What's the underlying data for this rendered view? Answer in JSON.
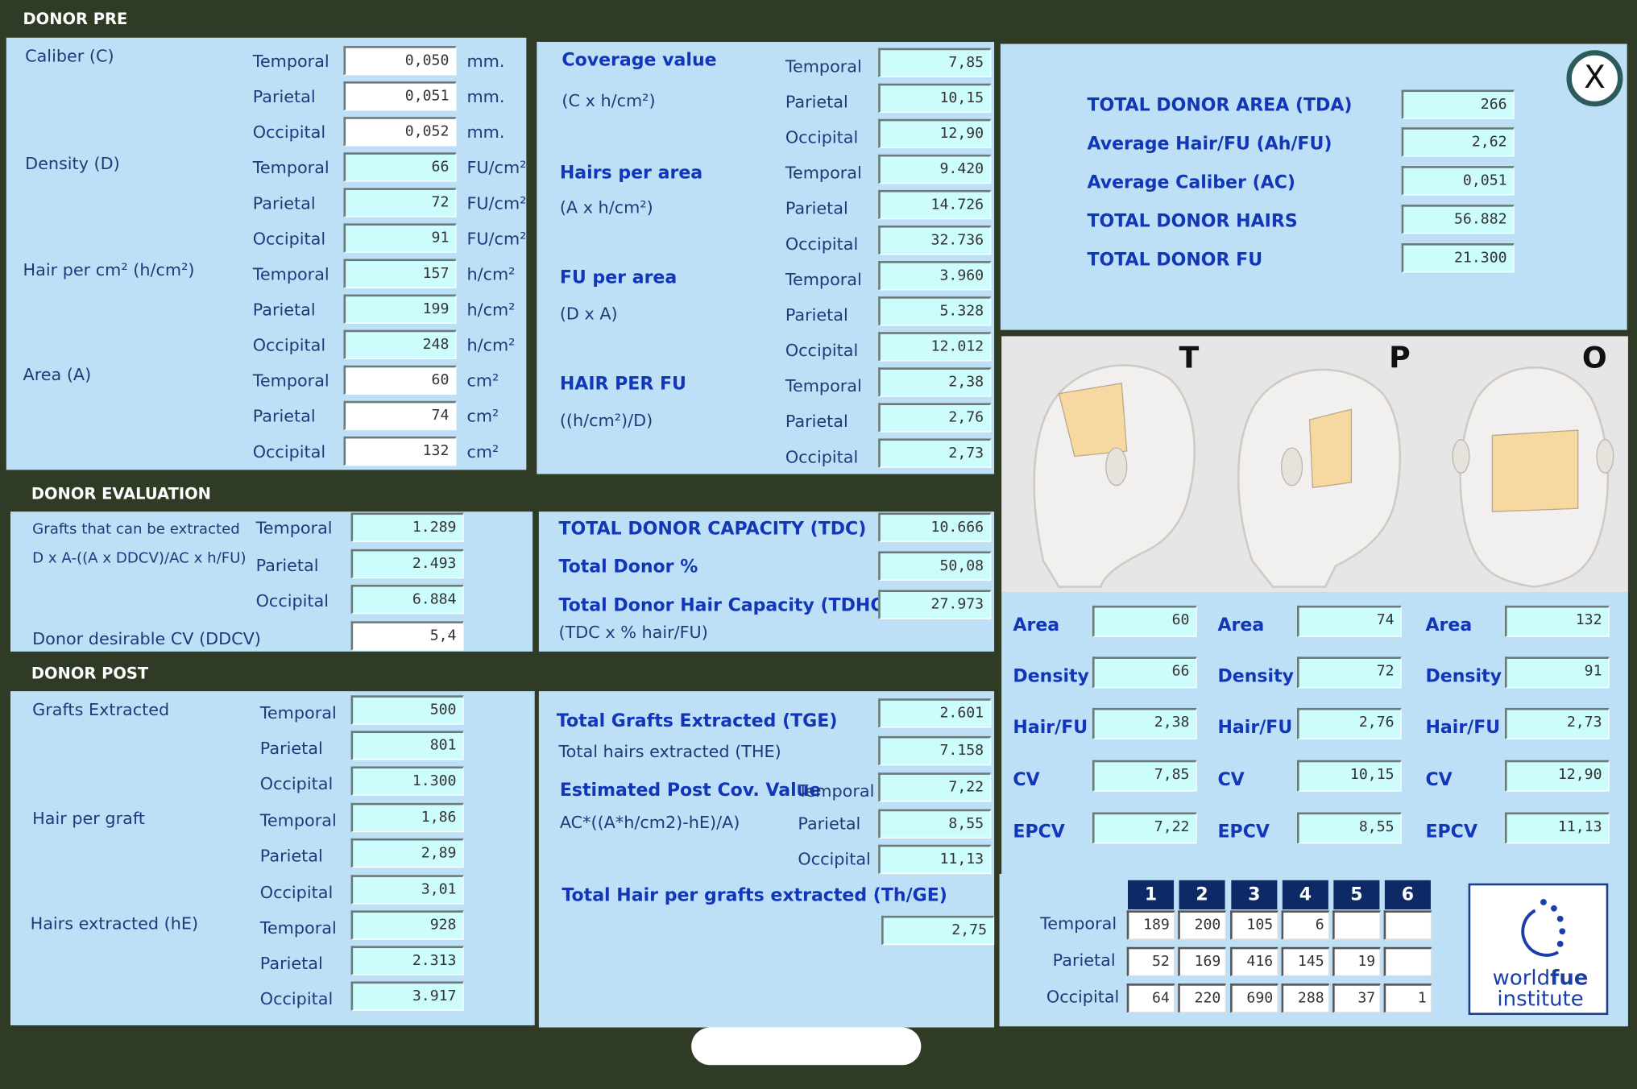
{
  "donor_pre": {
    "header": "DONOR PRE",
    "caliber_label": "Caliber (C)",
    "density_label": "Density (D)",
    "hair_per_cm_label": "Hair per cm² (h/cm²)",
    "area_label": "Area (A)",
    "rows": [
      {
        "region": "Temporal",
        "value": "0,050",
        "unit": "mm."
      },
      {
        "region": "Parietal",
        "value": "0,051",
        "unit": "mm."
      },
      {
        "region": "Occipital",
        "value": "0,052",
        "unit": "mm."
      },
      {
        "region": "Temporal",
        "value": "66",
        "unit": "FU/cm²"
      },
      {
        "region": "Parietal",
        "value": "72",
        "unit": "FU/cm²"
      },
      {
        "region": "Occipital",
        "value": "91",
        "unit": "FU/cm²"
      },
      {
        "region": "Temporal",
        "value": "157",
        "unit": "h/cm²"
      },
      {
        "region": "Parietal",
        "value": "199",
        "unit": "h/cm²"
      },
      {
        "region": "Occipital",
        "value": "248",
        "unit": "h/cm²"
      },
      {
        "region": "Temporal",
        "value": "60",
        "unit": "cm²"
      },
      {
        "region": "Parietal",
        "value": "74",
        "unit": "cm²"
      },
      {
        "region": "Occipital",
        "value": "132",
        "unit": "cm²"
      }
    ]
  },
  "middle_top": {
    "coverage_label": "Coverage value",
    "coverage_formula": "(C x h/cm²)",
    "hairs_area_label": "Hairs per area",
    "hairs_area_formula": "(A x h/cm²)",
    "fu_area_label": "FU per area",
    "fu_area_formula": "(D x A)",
    "hair_fu_label": "HAIR PER FU",
    "hair_fu_formula": "((h/cm²)/D)",
    "rows": [
      {
        "region": "Temporal",
        "value": "7,85"
      },
      {
        "region": "Parietal",
        "value": "10,15"
      },
      {
        "region": "Occipital",
        "value": "12,90"
      },
      {
        "region": "Temporal",
        "value": "9.420"
      },
      {
        "region": "Parietal",
        "value": "14.726"
      },
      {
        "region": "Occipital",
        "value": "32.736"
      },
      {
        "region": "Temporal",
        "value": "3.960"
      },
      {
        "region": "Parietal",
        "value": "5.328"
      },
      {
        "region": "Occipital",
        "value": "12.012"
      },
      {
        "region": "Temporal",
        "value": "2,38"
      },
      {
        "region": "Parietal",
        "value": "2,76"
      },
      {
        "region": "Occipital",
        "value": "2,73"
      }
    ]
  },
  "totals": {
    "tda_label": "TOTAL DONOR AREA (TDA)",
    "tda": "266",
    "ahfu_label": "Average Hair/FU (Ah/FU)",
    "ahfu": "2,62",
    "ac_label": "Average Caliber (AC)",
    "ac": "0,051",
    "hairs_label": "TOTAL DONOR HAIRS",
    "hairs": "56.882",
    "fu_label": "TOTAL DONOR FU",
    "fu": "21.300",
    "close": "X"
  },
  "heads": {
    "t": "T",
    "p": "P",
    "o": "O"
  },
  "head_stats": {
    "area_label": "Area",
    "density_label": "Density",
    "hairfu_label": "Hair/FU",
    "cv_label": "CV",
    "epcv_label": "EPCV",
    "temporal": {
      "area": "60",
      "density": "66",
      "hairfu": "2,38",
      "cv": "7,85",
      "epcv": "7,22"
    },
    "parietal": {
      "area": "74",
      "density": "72",
      "hairfu": "2,76",
      "cv": "10,15",
      "epcv": "8,55"
    },
    "occipital": {
      "area": "132",
      "density": "91",
      "hairfu": "2,73",
      "cv": "12,90",
      "epcv": "11,13"
    }
  },
  "donor_eval": {
    "header": "DONOR EVALUATION",
    "grafts_label": "Grafts that can be extracted",
    "grafts_formula": "D x A-((A x DDCV)/AC x h/FU)",
    "temporal_label": "Temporal",
    "temporal": "1.289",
    "parietal_label": "Parietal",
    "parietal": "2.493",
    "occipital_label": "Occipital",
    "occipital": "6.884",
    "ddcv_label": "Donor desirable CV (DDCV)",
    "ddcv": "5,4"
  },
  "capacity": {
    "tdc_label": "TOTAL DONOR CAPACITY (TDC)",
    "tdc": "10.666",
    "pct_label": "Total Donor %",
    "pct": "50,08",
    "tdhc_label": "Total Donor Hair Capacity (TDHC)",
    "tdhc": "27.973",
    "tdhc_formula": "(TDC x % hair/FU)"
  },
  "donor_post": {
    "header": "DONOR POST",
    "grafts_label": "Grafts Extracted",
    "hpg_label": "Hair per graft",
    "he_label": "Hairs extracted (hE)",
    "rows": [
      {
        "region": "Temporal",
        "value": "500"
      },
      {
        "region": "Parietal",
        "value": "801"
      },
      {
        "region": "Occipital",
        "value": "1.300"
      },
      {
        "region": "Temporal",
        "value": "1,86"
      },
      {
        "region": "Parietal",
        "value": "2,89"
      },
      {
        "region": "Occipital",
        "value": "3,01"
      },
      {
        "region": "Temporal",
        "value": "928"
      },
      {
        "region": "Parietal",
        "value": "2.313"
      },
      {
        "region": "Occipital",
        "value": "3.917"
      }
    ]
  },
  "post_totals": {
    "tge_label": "Total Grafts Extracted (TGE)",
    "tge": "2.601",
    "the_label": "Total hairs extracted (THE)",
    "the": "7.158",
    "epcv_label": "Estimated Post Cov. Value",
    "epcv_temporal_label": "Temporal",
    "epcv_temporal": "7,22",
    "epcv_formula": "AC*((A*h/cm2)-hE)/A)",
    "epcv_parietal_label": "Parietal",
    "epcv_parietal": "8,55",
    "epcv_occipital_label": "Occipital",
    "epcv_occipital": "11,13",
    "thge_label": "Total Hair per grafts extracted (Th/GE)",
    "thge": "2,75"
  },
  "grid": {
    "cols": [
      "1",
      "2",
      "3",
      "4",
      "5",
      "6"
    ],
    "rows": [
      {
        "label": "Temporal",
        "cells": [
          "189",
          "200",
          "105",
          "6",
          "",
          ""
        ]
      },
      {
        "label": "Parietal",
        "cells": [
          "52",
          "169",
          "416",
          "145",
          "19",
          ""
        ]
      },
      {
        "label": "Occipital",
        "cells": [
          "64",
          "220",
          "690",
          "288",
          "37",
          "1"
        ]
      }
    ]
  },
  "logo": {
    "line1": "world",
    "line1b": "fue",
    "line2": "institute"
  }
}
